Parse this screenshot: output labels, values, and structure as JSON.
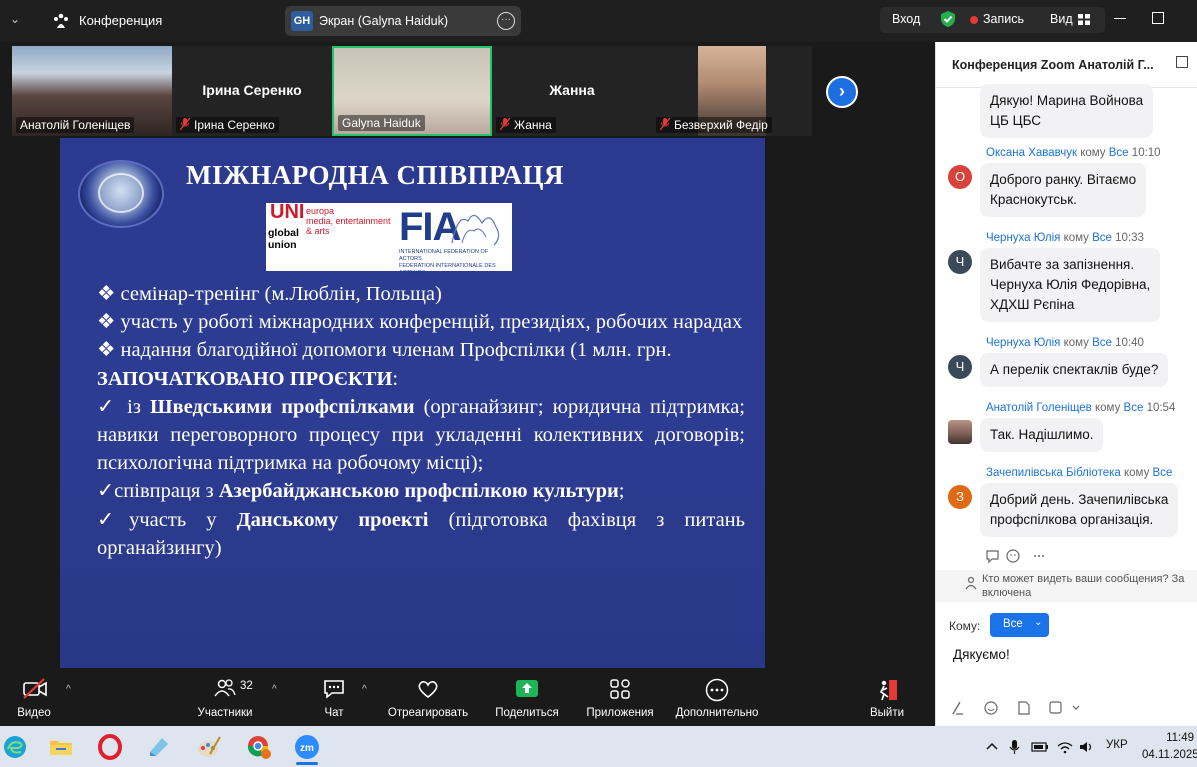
{
  "topbar": {
    "conference_title": "Конференция",
    "share": {
      "initials": "GH",
      "label": "Экран (Galyna Haiduk)"
    },
    "enter_label": "Вход",
    "record_label": "Запись",
    "view_label": "Вид"
  },
  "gallery": {
    "tiles": [
      {
        "name": "Анатолій Голеніщев",
        "muted": false,
        "video": true
      },
      {
        "name": "Ірина Серенко",
        "center_name": "Ірина Серенко",
        "muted": true,
        "video": false
      },
      {
        "name": "Galyna Haiduk",
        "muted": false,
        "video": true,
        "active_speaker": true
      },
      {
        "name": "Жанна",
        "center_name": "Жанна",
        "muted": true,
        "video": false
      },
      {
        "name": "Безверхий Федір",
        "muted": true,
        "video": true
      }
    ]
  },
  "slide": {
    "title": "МІЖНАРОДНА СПІВПРАЦЯ",
    "logo_uni_line1": "UNI",
    "logo_uni_line2": "global",
    "logo_uni_line3": "union",
    "logo_europa": "europa\nmedia, entertainment\n& arts",
    "logo_fia": "FIA",
    "logo_fia_sub": "INTERNATIONAL FEDERATION OF ACTORS\nFEDERATION INTERNATIONALE DES ACTEURS",
    "bullet1": "❖  семінар-тренінг (м.Люблін, Польща)",
    "bullet2": "❖ участь у роботі міжнародних конференцій,  президіях, робочих нарадах",
    "bullet3": "❖ надання благодійної допомоги членам Профспілки (1 млн. грн.",
    "projects_heading": "ЗАПОЧАТКОВАНО ПРОЄКТИ",
    "projects_colon": ":",
    "p1_prefix": "✓ із ",
    "p1_bold": "Шведськими профспілками",
    "p1_rest": " (органайзинг;  юридична підтримка;  навики переговорного  процесу при укладенні колективних договорів;  психологічна підтримка на робочому місці);",
    "p2_prefix": "✓співпраця з ",
    "p2_bold": "Азербайджанською профспілкою культури",
    "p2_rest": ";",
    "p3_prefix": "✓участь у ",
    "p3_bold": "Данському проекті",
    "p3_rest": " (підготовка фахівця з питань органайзингу)"
  },
  "toolbar": {
    "video": "Видео",
    "participants": "Участники",
    "participants_count": "32",
    "chat": "Чат",
    "react": "Отреагировать",
    "share": "Поделиться",
    "apps": "Приложения",
    "more": "Дополнительно",
    "exit": "Выйти"
  },
  "chat": {
    "title": "Конференция Zoom Анатолій Г...",
    "messages": [
      {
        "text": "Дякую!  Марина Войнова\nЦБ ЦБС"
      },
      {
        "sender": "Оксана Хававчук",
        "to_word": "кому",
        "to": "Все",
        "time": "10:10",
        "avatar": "О",
        "text": "Доброго ранку. Вітаємо\nКраснокутськ."
      },
      {
        "sender": "Чернуха Юлія",
        "to_word": "кому",
        "to": "Все",
        "time": "10:33",
        "avatar": "Ч",
        "text": "Вибачте за запізнення.\nЧернуха Юлія Федорівна,\nХДХШ Рєпіна"
      },
      {
        "sender": "Чернуха Юлія",
        "to_word": "кому",
        "to": "Все",
        "time": "10:40",
        "avatar": "Ч",
        "text": "А перелік спектаклів буде?"
      },
      {
        "sender": "Анатолій Голеніщев",
        "to_word": "кому",
        "to": "Все",
        "time": "10:54",
        "text": "Так. Надішлимо."
      },
      {
        "sender": "Зачепилівська Бібліотека",
        "to_word": "кому",
        "to": "Все",
        "avatar": "З",
        "text": "Добрий день. Зачепилівська\nпрофспілкова організація."
      }
    ],
    "privacy_note": "Кто может видеть ваши сообщения? За\nвключена",
    "to_label": "Кому:",
    "to_value": "Все",
    "draft": "Дякуємо!"
  },
  "taskbar": {
    "language": "УКР",
    "time": "11:49",
    "date": "04.11.2025"
  },
  "colors": {
    "accent_blue": "#1a73e8",
    "active_speaker": "#24c36a",
    "slide_bg": "#2b3a8e",
    "record_red": "#e53935",
    "share_green": "#1fb35a"
  }
}
